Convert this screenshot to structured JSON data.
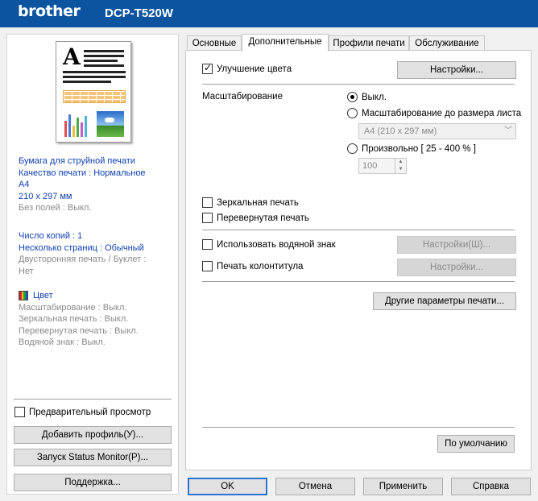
{
  "header": {
    "brand": "brother",
    "model": "DCP-T520W",
    "background": "#0c54a0"
  },
  "summary": {
    "paper_type": "Бумага для струйной печати",
    "quality": "Качество печати : Нормальное",
    "paper_size": "A4",
    "dimensions": "210 x 297 мм",
    "borderless": "Без полей : Выкл.",
    "copies": "Число копий : 1",
    "multipage": "Несколько страниц : Обычный",
    "duplex_line1": "Двусторонняя печать / Буклет :",
    "duplex_line2": "Нет",
    "color": "Цвет",
    "scaling": "Масштабирование : Выкл.",
    "mirror": "Зеркальная печать : Выкл.",
    "reverse": "Перевернутая печать : Выкл.",
    "watermark": "Водяной знак : Выкл."
  },
  "left_controls": {
    "preview_label": "Предварительный просмотр",
    "add_profile": "Добавить профиль(У)...",
    "status_monitor": "Запуск Status Monitor(P)...",
    "support": "Поддержка..."
  },
  "tabs": [
    "Основные",
    "Дополнительные",
    "Профили печати",
    "Обслуживание"
  ],
  "advanced": {
    "color_enhance_label": "Улучшение цвета",
    "color_enhance_checked": true,
    "settings_button": "Настройки...",
    "scaling_label": "Масштабирование",
    "scaling_off": "Выкл.",
    "scaling_fit": "Масштабирование до размера листа",
    "scaling_fit_value": "A4 (210 x 297 мм)",
    "scaling_custom": "Произвольно [ 25 - 400 % ]",
    "scaling_custom_value": "100",
    "mirror_label": "Зеркальная печать",
    "reverse_label": "Перевернутая печать",
    "watermark_label": "Использовать водяной знак",
    "watermark_settings": "Настройки(Ш)...",
    "header_footer_label": "Печать колонтитула",
    "header_footer_settings": "Настройки...",
    "other_params": "Другие параметры печати...",
    "defaults": "По умолчанию"
  },
  "footer": {
    "ok": "OK",
    "cancel": "Отмена",
    "apply": "Применить",
    "help": "Справка"
  }
}
